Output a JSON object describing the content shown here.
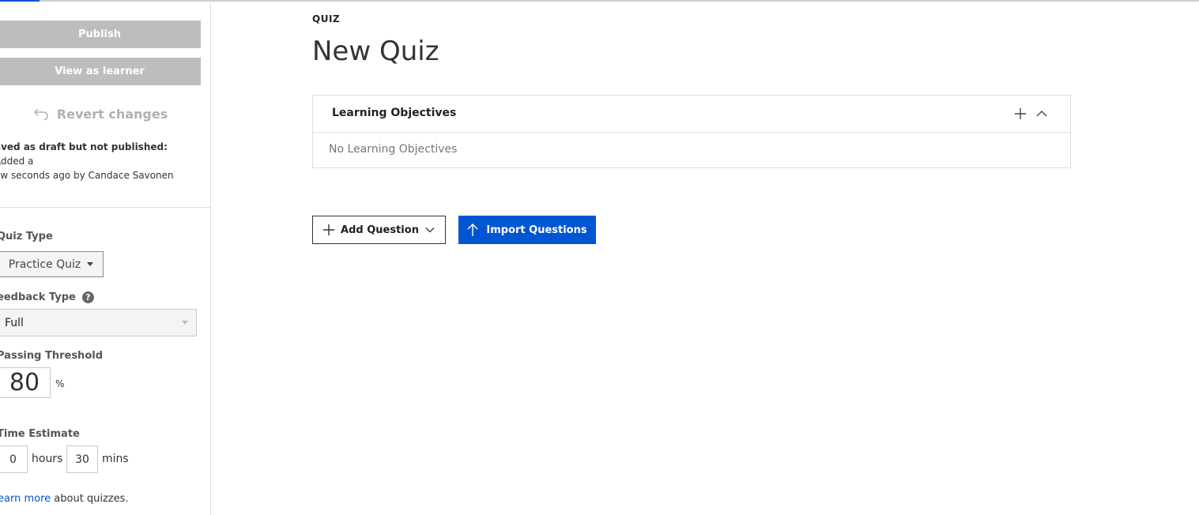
{
  "sidebar": {
    "publish_label": "Publish",
    "view_as_learner_label": "View as learner",
    "revert_label": "Revert changes",
    "draft_status_bold": "aved as draft but not published:",
    "draft_status_text": "Added a",
    "draft_status_text_2": "ew seconds ago by Candace Savonen",
    "quiz_type": {
      "label": "Quiz Type",
      "selected": "Practice Quiz"
    },
    "feedback_type": {
      "label": "eedback Type",
      "selected": "Full"
    },
    "passing_threshold": {
      "label": "Passing Threshold",
      "value": "80",
      "unit": "%"
    },
    "time_estimate": {
      "label": "Time Estimate",
      "hours_value": "0",
      "hours_unit": "hours",
      "mins_value": "30",
      "mins_unit": "mins"
    },
    "learn_more": {
      "link_text": "earn more",
      "suffix": "about quizzes."
    }
  },
  "main": {
    "eyebrow": "QUIZ",
    "title": "New Quiz",
    "learning_objectives": {
      "title": "Learning Objectives",
      "empty_text": "No Learning Objectives"
    },
    "add_question_label": "Add Question",
    "import_questions_label": "Import Questions"
  },
  "colors": {
    "accent": "#0056d2",
    "disabled_button": "#bdbdbd"
  },
  "icons": [
    "undo-icon",
    "help-icon",
    "plus-icon",
    "chevron-up-icon",
    "chevron-down-icon",
    "arrow-up-icon"
  ]
}
